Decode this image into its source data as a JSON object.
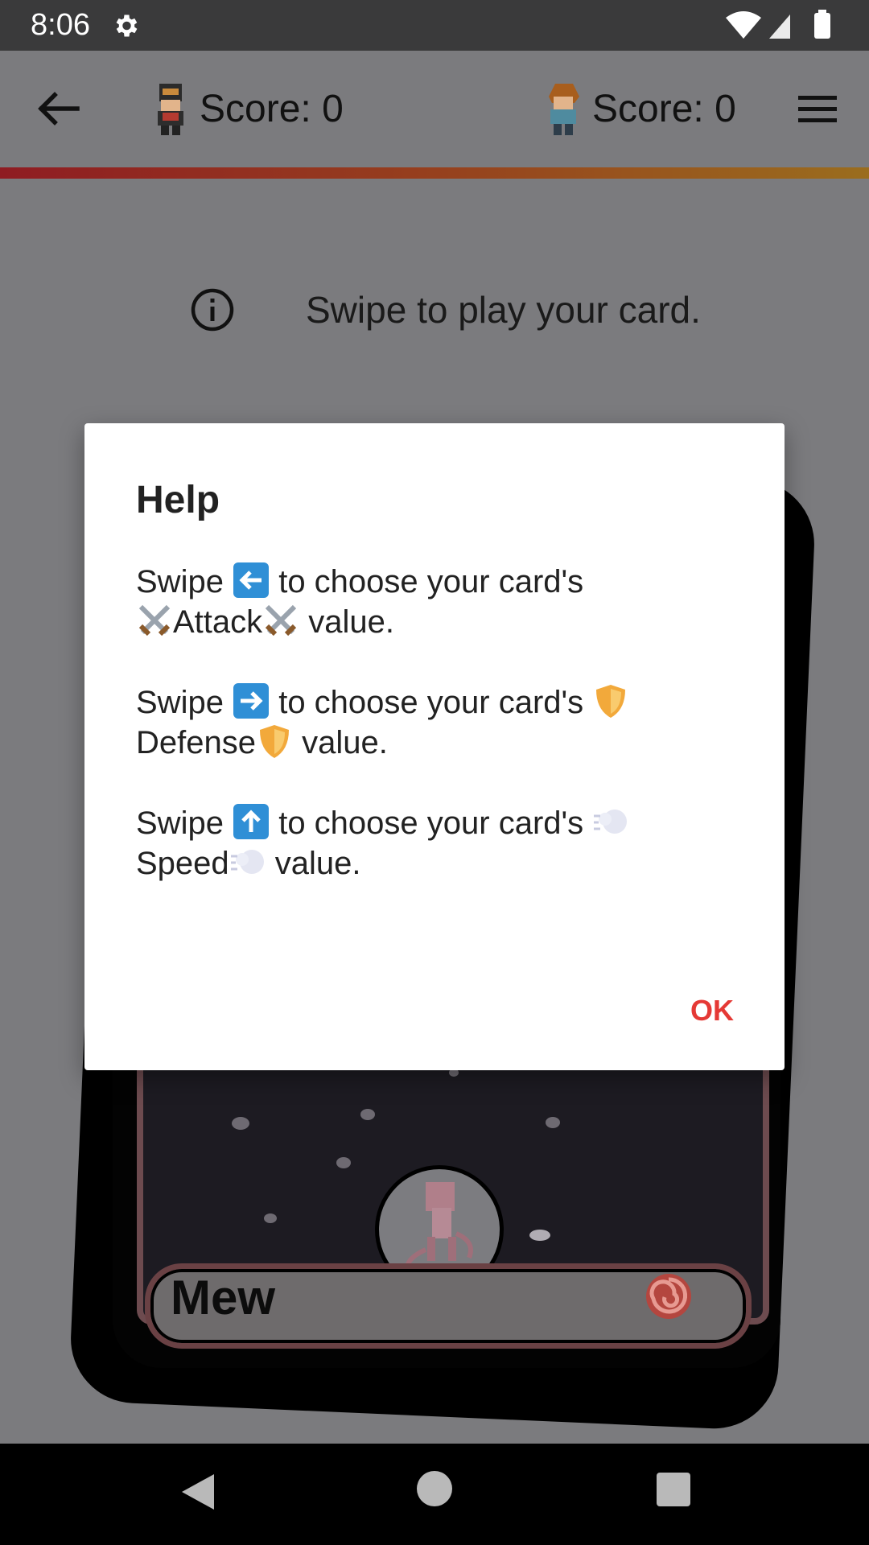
{
  "status_bar": {
    "time": "8:06"
  },
  "header": {
    "player1_score": "Score: 0",
    "player2_score": "Score: 0"
  },
  "hint": {
    "text": "Swipe to play your card."
  },
  "card": {
    "name": "Mew"
  },
  "dialog": {
    "title": "Help",
    "attack": {
      "pre": "Swipe",
      "mid": "to choose your card's",
      "label": "Attack",
      "post": "value."
    },
    "defense": {
      "pre": "Swipe",
      "mid": "to choose your card's",
      "label": "Defense",
      "post": "value."
    },
    "speed": {
      "pre": "Swipe",
      "mid": "to choose your card's",
      "label": "Speed",
      "post": "value."
    },
    "ok_label": "OK"
  },
  "colors": {
    "accent_ok": "#e53935",
    "stripe_start": "#8f1c22",
    "stripe_end": "#9a6d1e",
    "scrim": "#7b7b7e"
  },
  "icons": [
    "gear-icon",
    "wifi-icon",
    "signal-icon",
    "battery-icon",
    "back-arrow-icon",
    "menu-icon",
    "info-icon",
    "arrow-left-emoji",
    "arrow-right-emoji",
    "arrow-up-emoji",
    "swords-emoji",
    "shield-emoji",
    "dash-emoji",
    "psychic-type-icon"
  ]
}
